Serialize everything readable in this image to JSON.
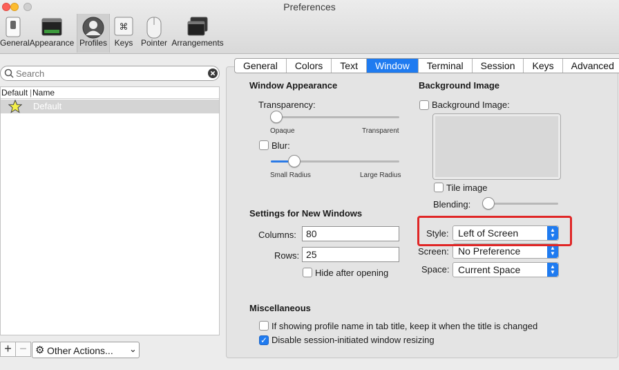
{
  "window": {
    "title": "Preferences"
  },
  "toolbar": {
    "items": [
      {
        "label": "General",
        "icon": "switch-icon"
      },
      {
        "label": "Appearance",
        "icon": "terminal-window-icon"
      },
      {
        "label": "Profiles",
        "icon": "person-icon"
      },
      {
        "label": "Keys",
        "icon": "command-key-icon"
      },
      {
        "label": "Pointer",
        "icon": "mouse-icon"
      },
      {
        "label": "Arrangements",
        "icon": "stacked-windows-icon"
      }
    ],
    "selected": "Profiles"
  },
  "search": {
    "placeholder": "Search",
    "value": ""
  },
  "profiles": {
    "columns": [
      "Default",
      "Name"
    ],
    "rows": [
      {
        "default": true,
        "name": "Default"
      }
    ]
  },
  "bottom_bar": {
    "add_label": "+",
    "remove_label": "−",
    "other_actions_label": "Other Actions...",
    "other_actions_arrow": "⌄"
  },
  "tabs": [
    "General",
    "Colors",
    "Text",
    "Window",
    "Terminal",
    "Session",
    "Keys",
    "Advanced"
  ],
  "active_tab": "Window",
  "window_appearance": {
    "title": "Window Appearance",
    "transparency_label": "Transparency:",
    "transparency_min": "Opaque",
    "transparency_max": "Transparent",
    "transparency_value": 0.0,
    "blur_label": "Blur:",
    "blur_checked": false,
    "blur_min": "Small Radius",
    "blur_max": "Large Radius",
    "blur_value": 0.15
  },
  "background_image": {
    "title": "Background Image",
    "checkbox_label": "Background Image:",
    "checked": false,
    "tile_label": "Tile image",
    "tile_checked": false,
    "blending_label": "Blending:",
    "blending_value": 0.0
  },
  "new_windows": {
    "title": "Settings for New Windows",
    "columns_label": "Columns:",
    "columns_value": "80",
    "rows_label": "Rows:",
    "rows_value": "25",
    "hide_label": "Hide after opening",
    "hide_checked": false,
    "style_label": "Style:",
    "style_value": "Left of Screen",
    "screen_label": "Screen:",
    "screen_value": "No Preference",
    "space_label": "Space:",
    "space_value": "Current Space"
  },
  "misc": {
    "title": "Miscellaneous",
    "keep_name_label": "If showing profile name in tab title, keep it when the title is changed",
    "keep_name_checked": false,
    "disable_resize_label": "Disable session-initiated window resizing",
    "disable_resize_checked": true
  },
  "colors": {
    "accent": "#1f7bf0",
    "highlight": "#e02626",
    "close": "#fc5f57",
    "minimize": "#fdbc2e"
  }
}
